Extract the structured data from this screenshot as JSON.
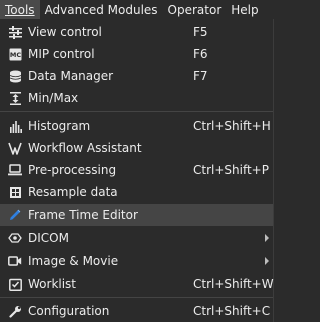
{
  "menubar": {
    "items": [
      {
        "label": "Tools",
        "active": true
      },
      {
        "label": "Advanced Modules"
      },
      {
        "label": "Operator"
      },
      {
        "label": "Help"
      }
    ]
  },
  "menu": {
    "items": [
      {
        "label": "View control",
        "shortcut": "F5",
        "icon": "sliders-icon"
      },
      {
        "label": "MIP control",
        "shortcut": "F6",
        "icon": "mip-icon"
      },
      {
        "label": "Data Manager",
        "shortcut": "F7",
        "icon": "database-icon"
      },
      {
        "label": "Min/Max",
        "shortcut": "",
        "icon": "minmax-icon"
      },
      {
        "label": "Histogram",
        "shortcut": "Ctrl+Shift+H",
        "icon": "histogram-icon"
      },
      {
        "label": "Workflow Assistant",
        "shortcut": "",
        "icon": "workflow-icon"
      },
      {
        "label": "Pre-processing",
        "shortcut": "Ctrl+Shift+P",
        "icon": "laptop-icon"
      },
      {
        "label": "Resample data",
        "shortcut": "",
        "icon": "resample-icon"
      },
      {
        "label": "Frame Time Editor",
        "shortcut": "",
        "icon": "pencil-icon",
        "highlighted": true
      },
      {
        "label": "DICOM",
        "shortcut": "",
        "icon": "dicom-icon",
        "submenu": true
      },
      {
        "label": "Image & Movie",
        "shortcut": "",
        "icon": "camera-icon",
        "submenu": true
      },
      {
        "label": "Worklist",
        "shortcut": "Ctrl+Shift+W",
        "icon": "worklist-icon"
      },
      {
        "label": "Configuration",
        "shortcut": "Ctrl+Shift+C",
        "icon": "wrench-icon"
      }
    ]
  },
  "colors": {
    "background": "#2b2b2b",
    "highlight": "#454545",
    "text": "#ececec",
    "pencil_accent": "#2f7fe0"
  }
}
